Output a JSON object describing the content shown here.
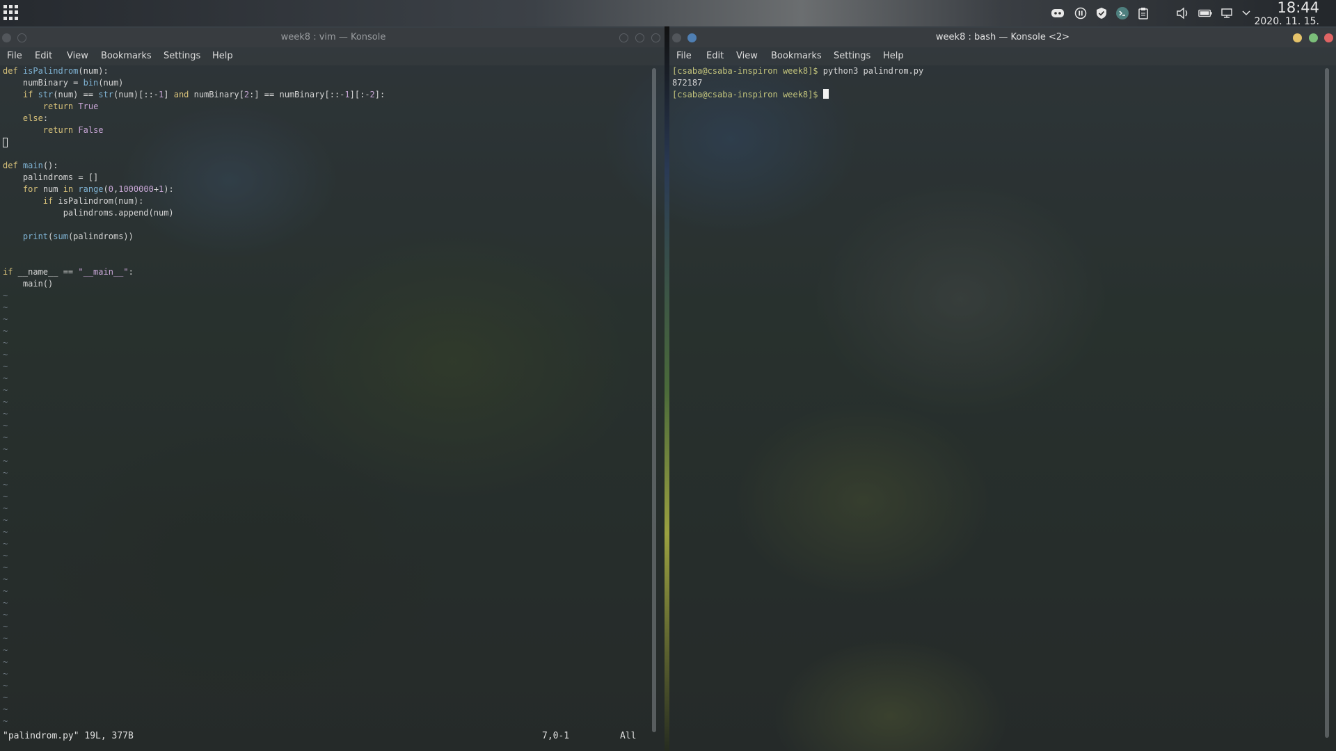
{
  "panel": {
    "clock_time": "18:44",
    "clock_date": "2020. 11. 15.",
    "tray_icons": [
      "discord-icon",
      "media-pause-icon",
      "vpn-shield-icon",
      "terminal-icon",
      "clipboard-icon",
      "volume-icon",
      "battery-icon",
      "display-icon",
      "chevron-down-icon"
    ]
  },
  "vim_window": {
    "title": "week8 : vim — Konsole",
    "menu": [
      "File",
      "Edit",
      "View",
      "Bookmarks",
      "Settings",
      "Help"
    ],
    "status_file": "\"palindrom.py\" 19L, 377B",
    "status_pos": "7,0-1",
    "status_scroll": "All",
    "tilde": "~"
  },
  "bash_window": {
    "title": "week8 : bash — Konsole <2>",
    "menu": [
      "File",
      "Edit",
      "View",
      "Bookmarks",
      "Settings",
      "Help"
    ],
    "prompt": "[csaba@csaba-inspiron week8]$",
    "command": " python3 palindrom.py",
    "output": "872187",
    "prompt2": "[csaba@csaba-inspiron week8]$"
  },
  "colors": {
    "keyword": "#d8c27a",
    "builtin": "#7fb3d4",
    "literal": "#c8a6d6",
    "prompt": "#c3c47c"
  }
}
